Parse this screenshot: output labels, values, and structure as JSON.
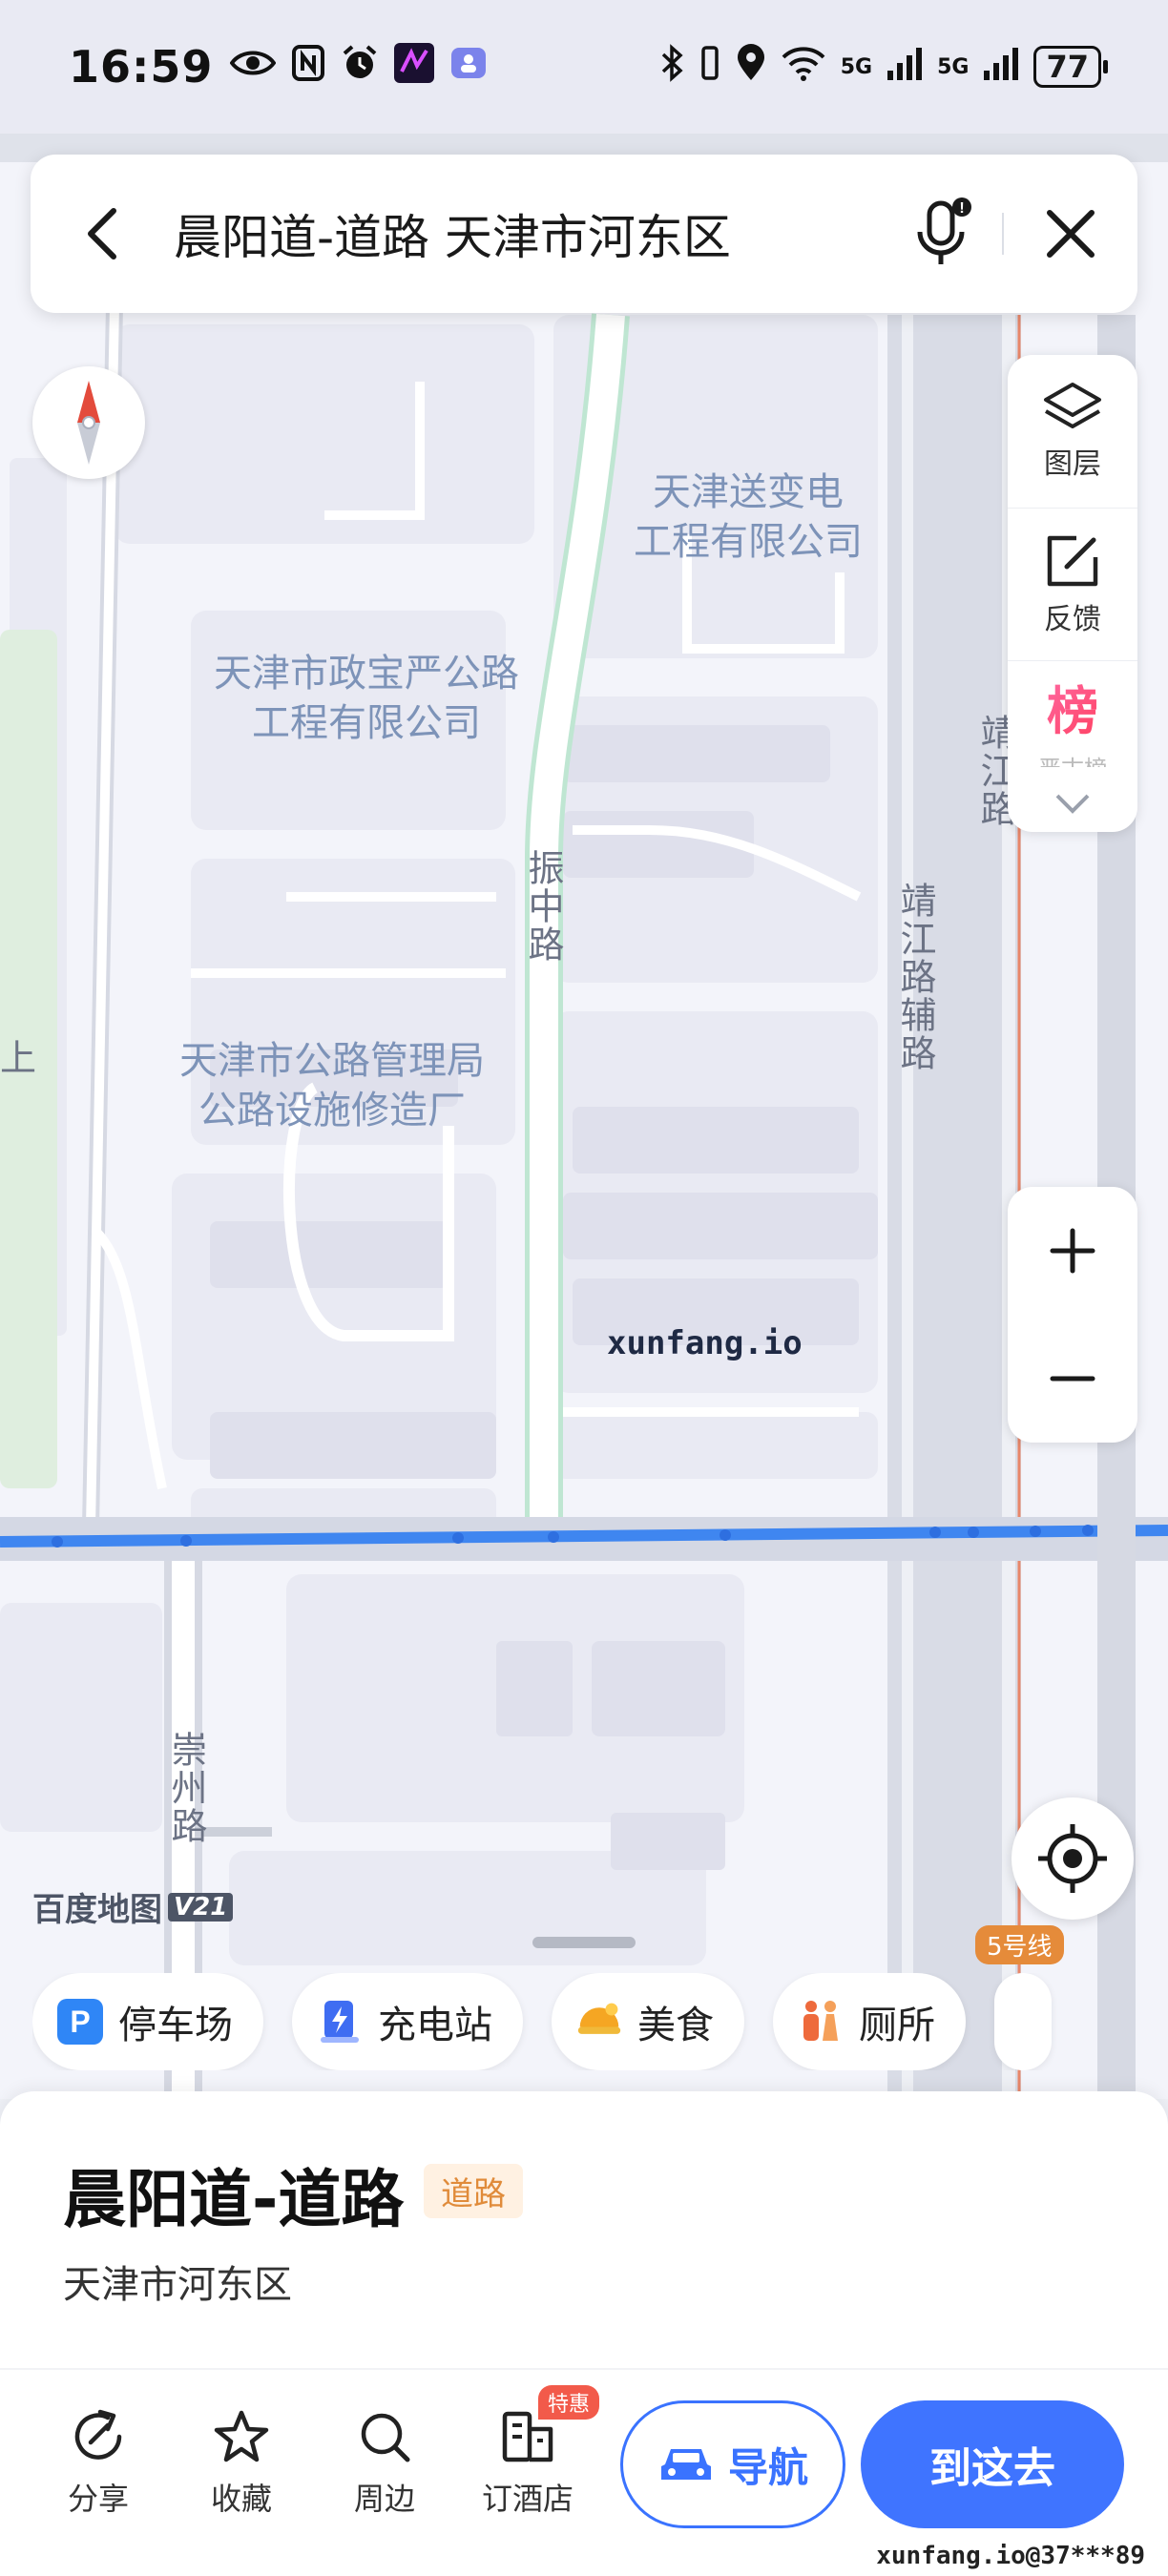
{
  "status_bar": {
    "time": "16:59",
    "battery": "77",
    "network1": "5G",
    "network2": "5G"
  },
  "search": {
    "query": "晨阳道-道路 天津市河东区"
  },
  "map": {
    "pois": [
      "天津送变电\n工程有限公司",
      "天津市政宝严公路\n工程有限公司",
      "天津市公路管理局\n公路设施修造厂"
    ],
    "roads": [
      "振中路",
      "靖江路辅路",
      "靖江路",
      "崇州路"
    ],
    "edge_label": "上",
    "watermark": "xunfang.io",
    "logo_text": "百度地图",
    "logo_version": "V21",
    "metro_label": "5号线"
  },
  "tools": {
    "layers_label": "图层",
    "feedback_label": "反馈",
    "rank_icon": "榜",
    "rank_label": "严古榜"
  },
  "poi_chips": [
    {
      "label": "停车场",
      "icon": "parking-icon",
      "color": "#2f86f6"
    },
    {
      "label": "充电站",
      "icon": "charging-icon",
      "color": "#3f6df2"
    },
    {
      "label": "美食",
      "icon": "food-icon",
      "color": "#f5a623"
    },
    {
      "label": "厕所",
      "icon": "toilet-icon",
      "color": "#ee6a3c"
    }
  ],
  "place": {
    "title": "晨阳道-道路",
    "tag": "道路",
    "address": "天津市河东区"
  },
  "actions": {
    "share": "分享",
    "favorite": "收藏",
    "nearby": "周边",
    "hotel": "订酒店",
    "hotel_badge": "特惠",
    "navigate": "导航",
    "go_here": "到这去"
  },
  "footer_watermark": "xunfang.io@37***89"
}
